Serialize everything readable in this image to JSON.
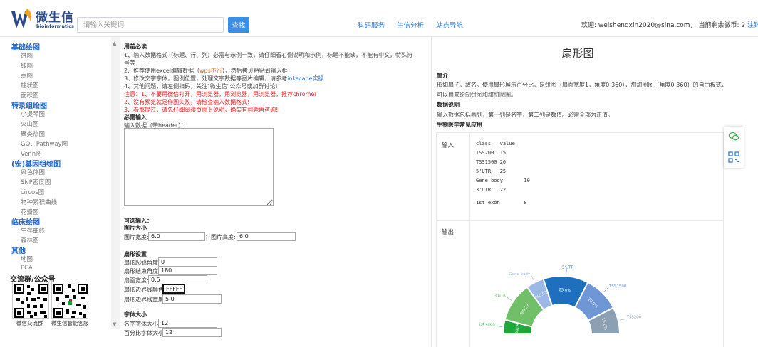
{
  "header": {
    "logo_cn": "微生信",
    "logo_en": "bioinformatics",
    "search_placeholder": "请输入关键词",
    "search_button": "查找",
    "nav": [
      {
        "label": "科研服务"
      },
      {
        "label": "生信分析"
      },
      {
        "label": "站点导航"
      }
    ],
    "welcome_prefix": "欢迎: ",
    "user_email": "weishengxin2020@sina.com",
    "coins_label": "， 当前剩余微币: ",
    "coins": "2",
    "logout": "注销"
  },
  "sidebar": {
    "categories": [
      {
        "title": "基础绘图",
        "items": [
          "饼图",
          "线图",
          "点图",
          "柱状图",
          "面积图"
        ]
      },
      {
        "title": "转录组绘图",
        "items": [
          "小提琴图",
          "火山图",
          "聚类热图",
          "GO、Pathway图",
          "Venn图"
        ]
      },
      {
        "title": "(宏)基因组绘图",
        "items": [
          "染色体图",
          "SNP密度图",
          "circos图",
          "物种累积曲线",
          "花瓣图"
        ]
      },
      {
        "title": "临床绘图",
        "items": [
          "生存曲线",
          "森林图"
        ]
      },
      {
        "title": "其他",
        "items": [
          "地图",
          "PCA"
        ]
      }
    ],
    "community_title": "交流群/公众号",
    "qr_labels": [
      "微信交流群",
      "微生信智能客服"
    ]
  },
  "form": {
    "notice_title": "用前必读",
    "notices": [
      "1、输入数据格式（标题、行、列）必需与示例一致，请仔细看右侧说明和示例，标题不能缺，不能有中文，特殊符",
      "号等"
    ],
    "notice2_a": "2、推荐使用excel编辑数据（",
    "notice2_wps": "wps不行",
    "notice2_b": "），然后拷贝粘贴到输入框",
    "notice3_a": "3、修改文字字体，图例位置，处理文字数据等图片编辑，请参考",
    "notice3_link": "inkscape实操",
    "notice4": "4、其他问题，请左侧扫码，关注\"微生信\"公众号或加群讨论!",
    "warnings": [
      "注意：1、不要用微信打开，用浏览器，用浏览器，用浏览器，推荐chrome!",
      "2、没有预览就是作图失败，请检查输入数据格式!",
      "3、看那提过，请先仔细阅读页面上说明，确实有问题再咨询!"
    ],
    "required_title": "必需输入",
    "input_label": "输入数据（带header）：",
    "optional_title": "可选输入：",
    "size_title": "图片大小",
    "width_label": "图片宽度:",
    "width_value": "6.0",
    "height_label": "；图片高度:",
    "height_value": "6.0",
    "sector_title": "扇形设置",
    "start_angle_label": "扇形起始角度:",
    "start_angle_value": "0",
    "end_angle_label": "扇形结束角度:",
    "end_angle_value": "180",
    "ring_width_label": "扇面宽度:",
    "ring_width_value": "0.5",
    "border_color_label": "扇形边界线颜色:",
    "border_color_value": "FFFFFF",
    "border_width_label": "扇形边界线宽度:",
    "border_width_value": "5.0",
    "font_title": "字体大小",
    "name_font_label": "名字字体大小:",
    "name_font_value": "12",
    "pct_font_label": "百分比字体大小:",
    "pct_font_value": "12"
  },
  "right": {
    "title": "扇形图",
    "intro_title": "简介",
    "intro_lines": [
      "形如扇子，故名。使用扇形展示百分比，是饼图（扇面宽度1，角度0-360），甜甜圈图（角度0-360）的自由板式，即：也",
      "可以用来绘制饼图和甜甜圈图。"
    ],
    "data_title": "数据说明",
    "data_line": "输入数据包括两列，第一列是名字，第二列是数值。必需全部为正值。",
    "app_title": "生物医学常见应用",
    "input_label": "输入",
    "sample_lines": [
      "class   value",
      "TSS200  15",
      "TSS1500 20",
      "5'UTR   25",
      "Gene body       10",
      "3'UTR   22",
      "1st exon        8"
    ],
    "output_label": "输出"
  },
  "chart_data": {
    "type": "pie",
    "variant": "half-donut",
    "start_angle": 0,
    "end_angle": 180,
    "categories": [
      "1st exon",
      "3'UTR",
      "Gene body",
      "5'UTR",
      "TSS1500",
      "TSS200"
    ],
    "values": [
      8,
      22,
      10,
      25,
      20,
      15
    ],
    "percent_labels": [
      "%0.8",
      "%0.22",
      "%0.01",
      "25.0%",
      "20.0%",
      "15.0%"
    ],
    "colors": [
      "#1ea83c",
      "#72bf6a",
      "#9bb8e6",
      "#1f6fbf",
      "#6f97d6",
      "#8ca0b4"
    ]
  }
}
